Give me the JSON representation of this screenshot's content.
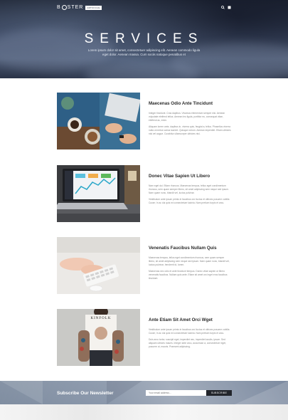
{
  "header": {
    "logo_prefix": "B",
    "logo_suffix": "STER",
    "logo_badge": "ARTIFICIAL",
    "icons": [
      "search-icon",
      "menu-icon"
    ]
  },
  "hero": {
    "title": "SERVICES",
    "subtitle": "Lorem ipsum dolor sit amet, consectetuer adipiscing elit. Aenean commodo ligula eget dolor. Aenean massa. Cum sociis natoque penatibus et"
  },
  "services": [
    {
      "title": "Maecenas Odio Ante Tincidunt",
      "para1": "Integer tincidunt. Cras dapibus. Vivamus elementum semper nisi. Aenean vulputate eleifend tellus. Aenean leo ligula, porttitor eu, consequat vitae, eleifend ac, enim.",
      "para2": "Aliquam lorem ante, dapibus in, viverra quis, feugiat a, tellus. Phasellus viverra nulla ut metus varius laoreet. Quisque rutrum. Aenean imperdiet. Etiam ultricies nisi vel augue. Curabitur ullamcorper ultricies nisi.",
      "image": "coffee-desk-photo"
    },
    {
      "title": "Donec Vitae Sapien Ut Libero",
      "para1": "Nam eget dui. Etiam rhoncus. Maecenas tempus, tellus eget condimentum rhoncus, sem quam semper libero, sit amet adipiscing sem neque sed ipsum. Nam quam nunc, blandit vel, luctus pulvinar.",
      "para2": "Vestibulum ante ipsum primis in faucibus orci luctus et ultrices posuere cubilia Curae; In ac dui quis mi consectetuer lacinia. Nam pretium turpis et arcu.",
      "image": "laptop-analytics-photo"
    },
    {
      "title": "Venenatis Faucibus Nullam Quis",
      "para1": "Maecenas tempus, tellus eget condimentum rhoncus, sem quam semper libero, sit amet adipiscing sem neque sed ipsum. Nam quam nunc, blandit vel, luctus pulvinar, hendrerit id, lorem.",
      "para2": "Maecenas nec odio et ante tincidunt tempus. Donec vitae sapien ut libero venenatis faucibus. Nullam quis ante. Etiam sit amet orci eget eros faucibus tincidunt.",
      "image": "keyboard-hands-photo"
    },
    {
      "title": "Ante Etiam Sit Amet Orci Wget",
      "para1": "Vestibulum ante ipsum primis in faucibus orci luctus et ultrices posuere cubilia Curae; In ac dui quis mi consectetuer lacinia. Nam pretium turpis et arcu.",
      "para2": "Duis arcu tortor, suscipit eget, imperdiet nec, imperdiet iaculis, ipsum. Sed aliquam ultrices mauris. Integer ante arcu, accumsan a, consectetuer eget, posuere ut, mauris. Praesent adipiscing.",
      "image": "kinfolk-magazine-photo",
      "image_text": "KINFOLK"
    }
  ],
  "newsletter": {
    "label": "Subscribe Our Newsletter",
    "placeholder": "Your email address...",
    "button": "SUBSCRIBE"
  }
}
